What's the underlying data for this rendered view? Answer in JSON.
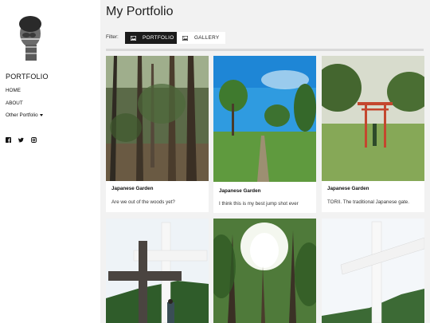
{
  "sidebar": {
    "site_title": "PORTFOLIO",
    "nav": [
      {
        "label": "HOME"
      },
      {
        "label": "ABOUT"
      },
      {
        "label": "Other Portfolio"
      }
    ],
    "social_icons": [
      "facebook-icon",
      "twitter-icon",
      "instagram-icon"
    ]
  },
  "main": {
    "page_title": "My Portfolio",
    "filter_label": "Filter:",
    "filters": [
      {
        "label": "PORTFOLIO",
        "active": true
      },
      {
        "label": "GALLERY",
        "active": false
      }
    ],
    "cards": [
      {
        "title": "Japanese Garden",
        "description": "Are we out of the woods yet?"
      },
      {
        "title": "Japanese Garden",
        "description": "I think this is my best jump shot ever"
      },
      {
        "title": "Japanese Garden",
        "description": "TORII. The traditional Japanese gate."
      },
      {
        "title": "",
        "description": ""
      },
      {
        "title": "",
        "description": ""
      },
      {
        "title": "",
        "description": ""
      }
    ]
  },
  "colors": {
    "background": "#f2f2f2",
    "active_filter": "#1b1b1b",
    "card": "#ffffff",
    "text": "#111111"
  }
}
